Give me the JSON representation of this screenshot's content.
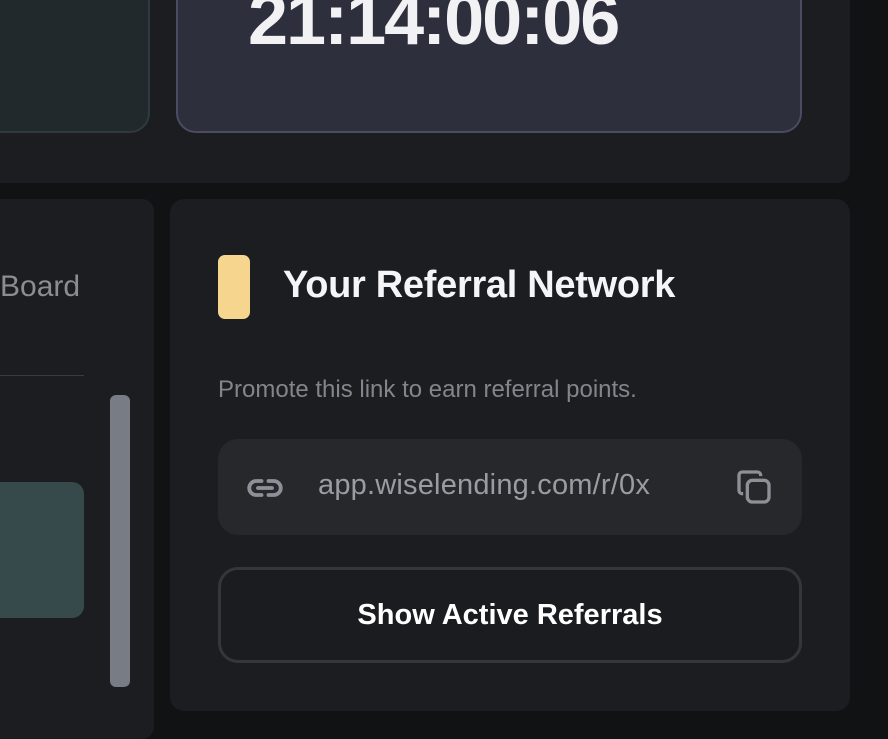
{
  "timer": {
    "value": "21:14:00:06"
  },
  "leaderboard": {
    "label_fragment": "Board"
  },
  "referral": {
    "title": "Your Referral Network",
    "subtitle": "Promote this link to earn referral points.",
    "link_text": "app.wiselending.com/r/0x",
    "link_icon": "link-icon",
    "copy_icon": "copy-icon",
    "button_label": "Show Active Referrals",
    "accent_color": "#f6d68f"
  }
}
